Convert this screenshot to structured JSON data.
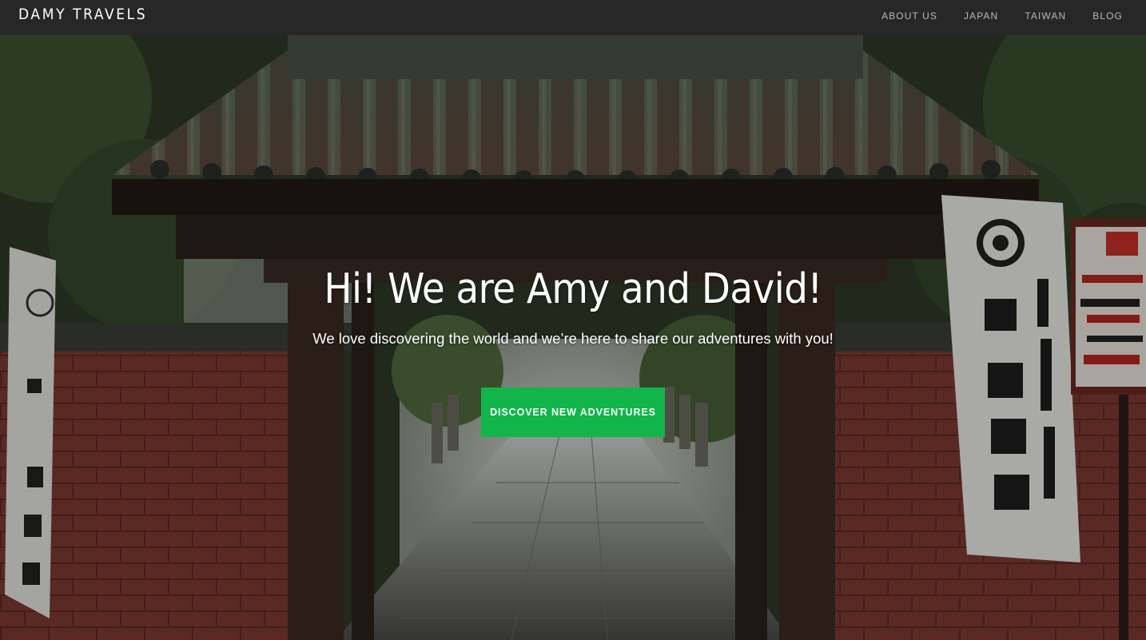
{
  "nav": {
    "brand": "DAMY TRAVELS",
    "links": [
      "ABOUT US",
      "JAPAN",
      "TAIWAN",
      "BLOG"
    ]
  },
  "hero": {
    "title": "Hi! We are Amy and David!",
    "subtitle": "We love discovering the world and we’re here to share our adventures with you!",
    "cta_label": "DISCOVER NEW ADVENTURES",
    "background_image": "shrine-gate-photo",
    "banner_left_text": "重要文化財 上野東照宮",
    "banner_right_text": "必勝(試合・試験・就職)祈願 上野東照宮",
    "sign_text": "文化財愛護 重要文化財 東照 1651年造 火気厳禁 HITACHI"
  },
  "colors": {
    "navbar_bg": "#272727",
    "cta_bg": "#11b54a",
    "nav_link": "#b8b8b8"
  }
}
